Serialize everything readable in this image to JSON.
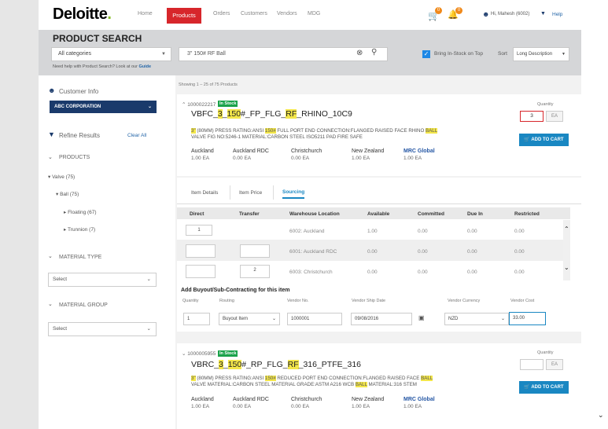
{
  "header": {
    "logo": "Deloitte",
    "logo_dot": ".",
    "nav": [
      "Home",
      "Products",
      "Orders",
      "Customers",
      "Vendors",
      "MDG"
    ],
    "cart_badge": "0",
    "notif_badge": "0",
    "user": "Hi, Mahesh (6002)",
    "help": "Help"
  },
  "search": {
    "title": "PRODUCT SEARCH",
    "category": "All categories",
    "query": "3\" 150# RF Ball",
    "help_text": "Need help with Product Search? Look at our",
    "help_link": "Guide",
    "instock_label": "Bring In-Stock on Top",
    "sort_label": "Sort",
    "sort_value": "Long Description"
  },
  "sidebar": {
    "customer_info": "Customer Info",
    "customer": "ABC CORPORATION",
    "refine": "Refine Results",
    "clear": "Clear All",
    "products": "PRODUCTS",
    "tree": [
      "Valve (75)",
      "Ball (75)",
      "Floating (67)",
      "Trunnion (7)"
    ],
    "material_type": "MATERIAL TYPE",
    "material_group": "MATERIAL GROUP",
    "select": "Select"
  },
  "results": {
    "count": "Showing 1 – 25 of 75 Products"
  },
  "products": [
    {
      "number": "1000022217",
      "stock": "In Stock",
      "title_parts": [
        "VBFC_",
        "3",
        "_",
        "150",
        "#_FP_FLG_",
        "RF",
        "_RHINO_10C9"
      ],
      "desc_parts": [
        "3\"",
        " (80MM) PRESS RATING:ANSI ",
        "150#",
        " FULL PORT END CONNECTION:FLANGED RAISED FACE RHINO ",
        "BALL"
      ],
      "desc2": "VALVE FIG NO:5246-1 MATERIAL:CARBON STEEL ISO5211 PAD FIRE SAFE",
      "quantity_label": "Quantity",
      "quantity": "3",
      "uom": "EA",
      "add_to_cart": "ADD TO CART",
      "locations": [
        {
          "name": "Auckland",
          "value": "1.00 EA"
        },
        {
          "name": "Auckland RDC",
          "value": "0.00 EA"
        },
        {
          "name": "Christchurch",
          "value": "0.00 EA"
        },
        {
          "name": "New Zealand",
          "value": "1.00 EA"
        },
        {
          "name": "MRC Global",
          "value": "1.00 EA"
        }
      ]
    },
    {
      "number": "1000005955",
      "stock": "In Stock",
      "title_parts": [
        "VBRC_",
        "3",
        "_",
        "150",
        "#_RP_FLG_",
        "RF",
        "_316_PTFE_316"
      ],
      "desc_parts": [
        "3\"",
        " (80MM) PRESS RATING:ANSI ",
        "150#",
        " REDUCED PORT END CONNECTION:FLANGED RAISED FACE ",
        "BALL"
      ],
      "desc2a": "VALVE MATERIAL:CARBON STEEL MATERIAL GRADE:ASTM A216 WCB ",
      "desc2b": "BALL",
      "desc2c": " MATERIAL:316 STEM",
      "quantity_label": "Quantity",
      "quantity": "",
      "uom": "EA",
      "add_to_cart": "ADD TO CART",
      "locations": [
        {
          "name": "Auckland",
          "value": "1.00 EA"
        },
        {
          "name": "Auckland RDC",
          "value": "0.00 EA"
        },
        {
          "name": "Christchurch",
          "value": "0.00 EA"
        },
        {
          "name": "New Zealand",
          "value": "1.00 EA"
        },
        {
          "name": "MRC Global",
          "value": "1.00 EA"
        }
      ]
    }
  ],
  "tabs": [
    "Item Details",
    "Item Price",
    "Sourcing"
  ],
  "sourcing": {
    "headers": [
      "Direct",
      "Transfer",
      "Warehouse Location",
      "Available",
      "Committed",
      "Due In",
      "Restricted"
    ],
    "rows": [
      {
        "direct": "1",
        "transfer": "",
        "location": "6002: Auckland",
        "available": "1.00",
        "committed": "0.00",
        "due": "0.00",
        "restricted": "0.00"
      },
      {
        "direct": "",
        "transfer": "",
        "location": "6001: Auckland RDC",
        "available": "0.00",
        "committed": "0.00",
        "due": "0.00",
        "restricted": "0.00"
      },
      {
        "direct": "",
        "transfer": "2",
        "location": "6003: Christchurch",
        "available": "0.00",
        "committed": "0.00",
        "due": "0.00",
        "restricted": "0.00"
      }
    ]
  },
  "buyout": {
    "title": "Add Buyout/Sub-Contracting for this item",
    "labels": [
      "Quantity",
      "Routing",
      "Vendor No.",
      "Vendor Ship Date",
      "Vendor Currency",
      "Vendor Cost"
    ],
    "quantity": "1",
    "routing": "Buyout Item",
    "vendor_no": "1000001",
    "ship_date": "09/08/2016",
    "currency": "NZD",
    "cost": "33.00"
  }
}
